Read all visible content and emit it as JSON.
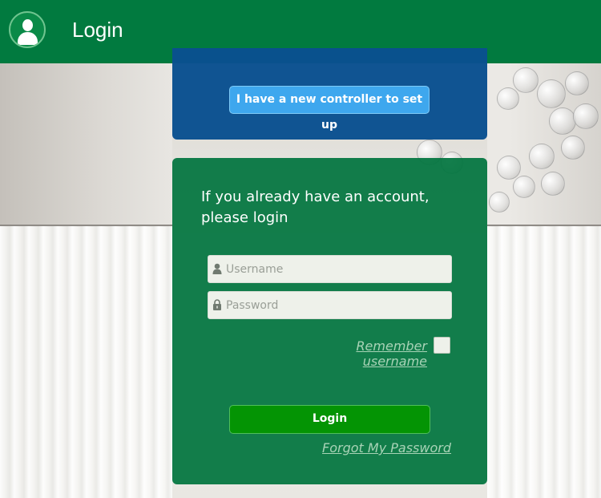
{
  "header": {
    "title": "Login",
    "avatar_icon": "user-icon",
    "background_color": "#017a3f"
  },
  "setup_panel": {
    "new_controller_label": "I have a new controller to set up",
    "background_color": "#094f8f",
    "button_color": "#3ea7ee"
  },
  "login_panel": {
    "intro_text": "If you already have an account, please login",
    "username": {
      "placeholder": "Username",
      "value": "",
      "icon": "user-icon"
    },
    "password": {
      "placeholder": "Password",
      "value": "",
      "icon": "lock-icon"
    },
    "remember_label": "Remember username",
    "remember_checked": false,
    "login_label": "Login",
    "forgot_label": "Forgot My Password",
    "background_color": "#01743e",
    "button_color": "#049404"
  }
}
